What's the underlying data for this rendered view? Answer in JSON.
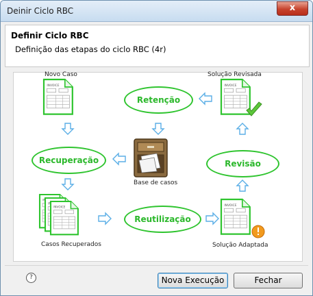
{
  "window": {
    "title": "Deinir Ciclo RBC",
    "close_glyph": "x"
  },
  "header": {
    "title": "Definir Ciclo RBC",
    "subtitle": "Definição das etapas do ciclo RBC (4r)"
  },
  "diagram": {
    "stages": {
      "retencao": "Retenção",
      "recuperacao": "Recuperação",
      "revisao": "Revisão",
      "reutilizacao": "Reutilização"
    },
    "labels": {
      "novo_caso": "Novo Caso",
      "solucao_revisada": "Solução Revisada",
      "base_de_casos": "Base de casos",
      "casos_recuperados": "Casos Recuperados",
      "solucao_adaptada": "Solução Adaptada"
    },
    "invoice_word": "INVOICE",
    "colors": {
      "stage_green": "#2ec42e",
      "arrow_blue": "#5aaee6"
    }
  },
  "footer": {
    "help_glyph": "?",
    "run_button": "Nova Execução",
    "close_button": "Fechar"
  }
}
